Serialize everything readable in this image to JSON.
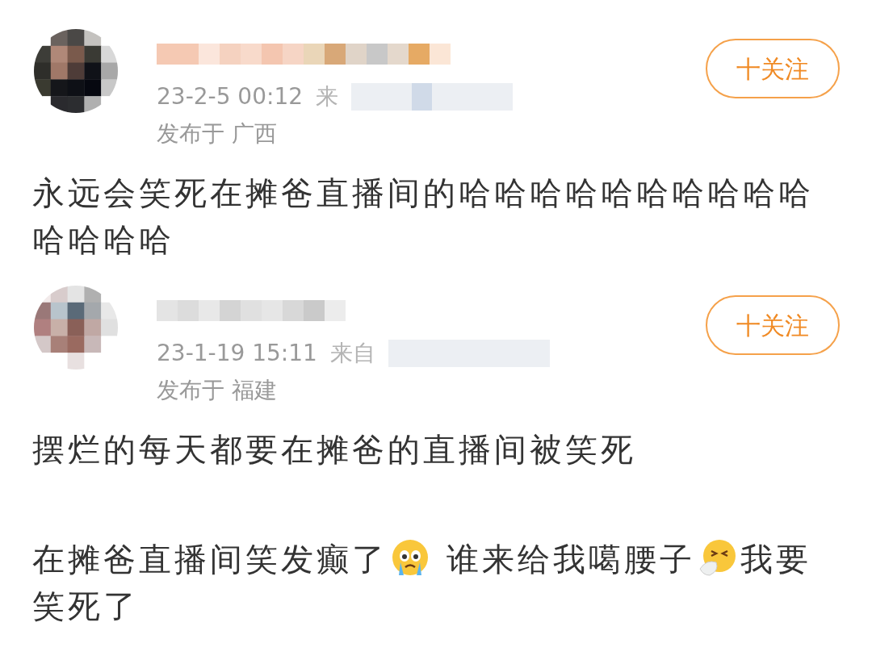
{
  "comments": [
    {
      "author": {
        "time": "23-2-5 00:12",
        "source": "来",
        "location": "发布于 广西",
        "follow": "十关注"
      },
      "segments": [
        {
          "kind": "text",
          "text": "永远会笑死在摊爸直播间的哈哈哈哈哈哈哈哈哈哈哈哈哈哈"
        }
      ]
    },
    {
      "author": {
        "time": "23-1-19 15:11",
        "source": "来自",
        "location": "发布于 福建",
        "follow": "十关注"
      },
      "segments": [
        {
          "kind": "text",
          "text": "摆烂的每天都要在摊爸的直播间被笑死"
        }
      ]
    },
    {
      "segments": [
        {
          "kind": "text",
          "text": "在摊爸直播间笑发癫了"
        },
        {
          "kind": "crying"
        },
        {
          "kind": "text",
          "text": " 谁来给我噶腰子"
        },
        {
          "kind": "sneezing"
        },
        {
          "kind": "text",
          "text": "我要"
        },
        {
          "kind": "text",
          "text": "笑死了"
        }
      ]
    }
  ]
}
